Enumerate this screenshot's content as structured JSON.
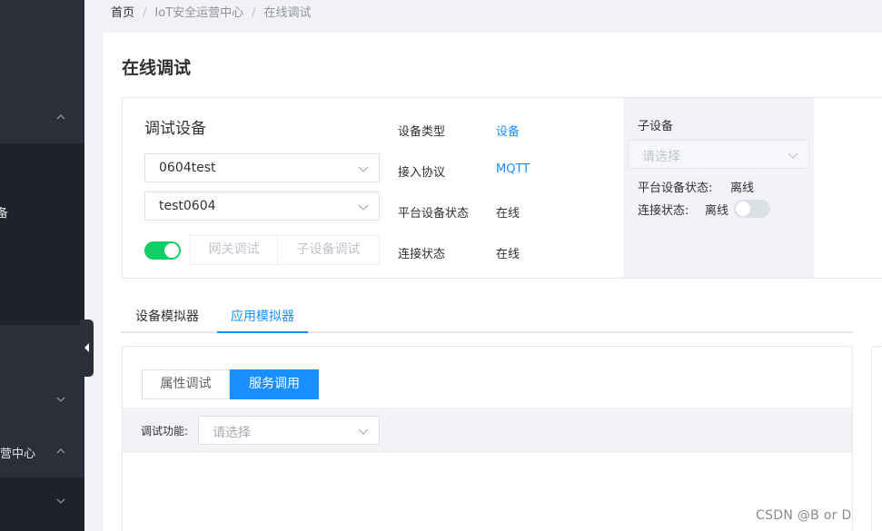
{
  "sidebar": {
    "partial_labels": [
      "备",
      "营中心"
    ]
  },
  "breadcrumb": {
    "items": [
      "首页",
      "IoT安全运营中心",
      "在线调试"
    ],
    "separator": "/"
  },
  "page": {
    "title": "在线调试"
  },
  "debug_device": {
    "title": "调试设备",
    "product_select_value": "0604test",
    "device_select_value": "test0604",
    "switch_on": true,
    "buttons": [
      "网关调试",
      "子设备调试"
    ]
  },
  "device_info": [
    {
      "label": "设备类型",
      "value": "设备",
      "is_link": true
    },
    {
      "label": "接入协议",
      "value": "MQTT",
      "is_link": true
    },
    {
      "label": "平台设备状态",
      "value": "在线",
      "is_link": false
    },
    {
      "label": "连接状态",
      "value": "在线",
      "is_link": false
    }
  ],
  "sub_device": {
    "title": "子设备",
    "select_placeholder": "请选择",
    "platform_status_label": "平台设备状态:",
    "platform_status_value": "离线",
    "connection_status_label": "连接状态:",
    "connection_status_value": "离线",
    "switch_on": false
  },
  "tabs": {
    "items": [
      "设备模拟器",
      "应用模拟器"
    ],
    "active_index": 1
  },
  "app_simulator": {
    "segments": [
      "属性调试",
      "服务调用"
    ],
    "active_segment_index": 1,
    "function_label": "调试功能:",
    "function_placeholder": "请选择"
  },
  "watermark": "CSDN @B   or   D",
  "colors": {
    "accent": "#1890ff",
    "switch_on": "#13ce66",
    "sidebar_bg": "#2b2f3a"
  }
}
